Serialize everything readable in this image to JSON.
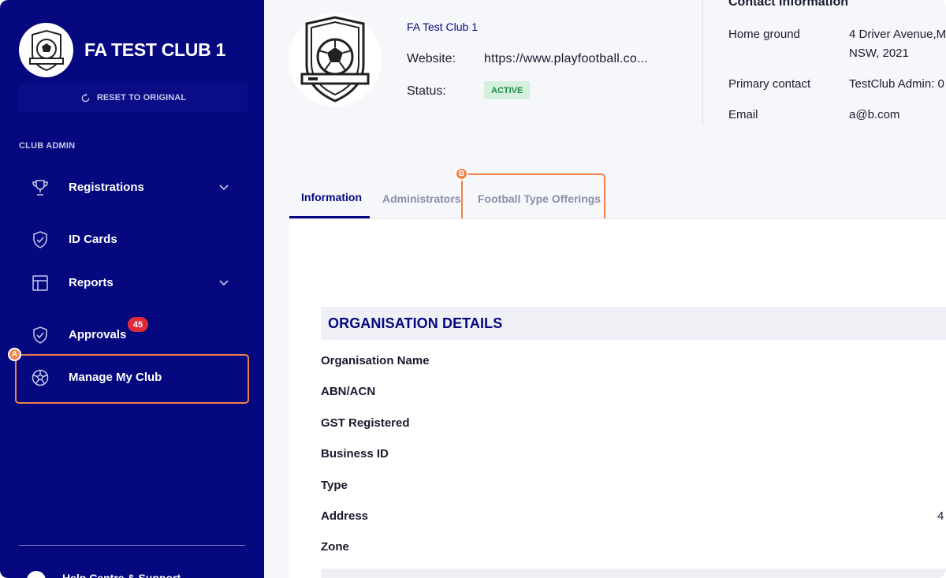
{
  "sidebar": {
    "club_name": "FA TEST CLUB 1",
    "reset_label": "RESET TO ORIGINAL",
    "section_label": "CLUB ADMIN",
    "items": [
      {
        "label": "Registrations",
        "icon": "trophy-icon"
      },
      {
        "label": "ID Cards",
        "icon": "shield-check-icon"
      },
      {
        "label": "Reports",
        "icon": "layout-grid-icon"
      },
      {
        "label": "Approvals",
        "icon": "shield-check-icon"
      },
      {
        "label": "Manage My Club",
        "icon": "soccer-ball-icon"
      }
    ],
    "approvals_badge": "45",
    "help_label": "Help Centre & Support"
  },
  "markers": {
    "a": "A",
    "b": "B"
  },
  "header": {
    "org_link": "FA Test Club 1",
    "website_label": "Website:",
    "website_value": "https://www.playfootball.co...",
    "status_label": "Status:",
    "status_value": "ACTIVE"
  },
  "contact": {
    "title": "Contact information",
    "home_ground_label": "Home ground",
    "home_ground_line1": "4 Driver Avenue,M",
    "home_ground_line2": "NSW, 2021",
    "primary_contact_label": "Primary contact",
    "primary_contact_value": "TestClub Admin: 0",
    "email_label": "Email",
    "email_value": "a@b.com"
  },
  "tabs": [
    {
      "label": "Information"
    },
    {
      "label": "Administrators"
    },
    {
      "label": "Football Type Offerings"
    }
  ],
  "details": {
    "title": "ORGANISATION DETAILS",
    "fields": [
      "Organisation Name",
      "ABN/ACN",
      "GST Registered",
      "Business ID",
      "Type",
      "Address",
      "Zone"
    ],
    "address_value": "4"
  },
  "colors": {
    "sidebar_bg": "#05087e",
    "accent": "#f0824a",
    "badge": "#e02a3a",
    "status_bg": "#d4f0dd",
    "status_text": "#1f8a45"
  }
}
